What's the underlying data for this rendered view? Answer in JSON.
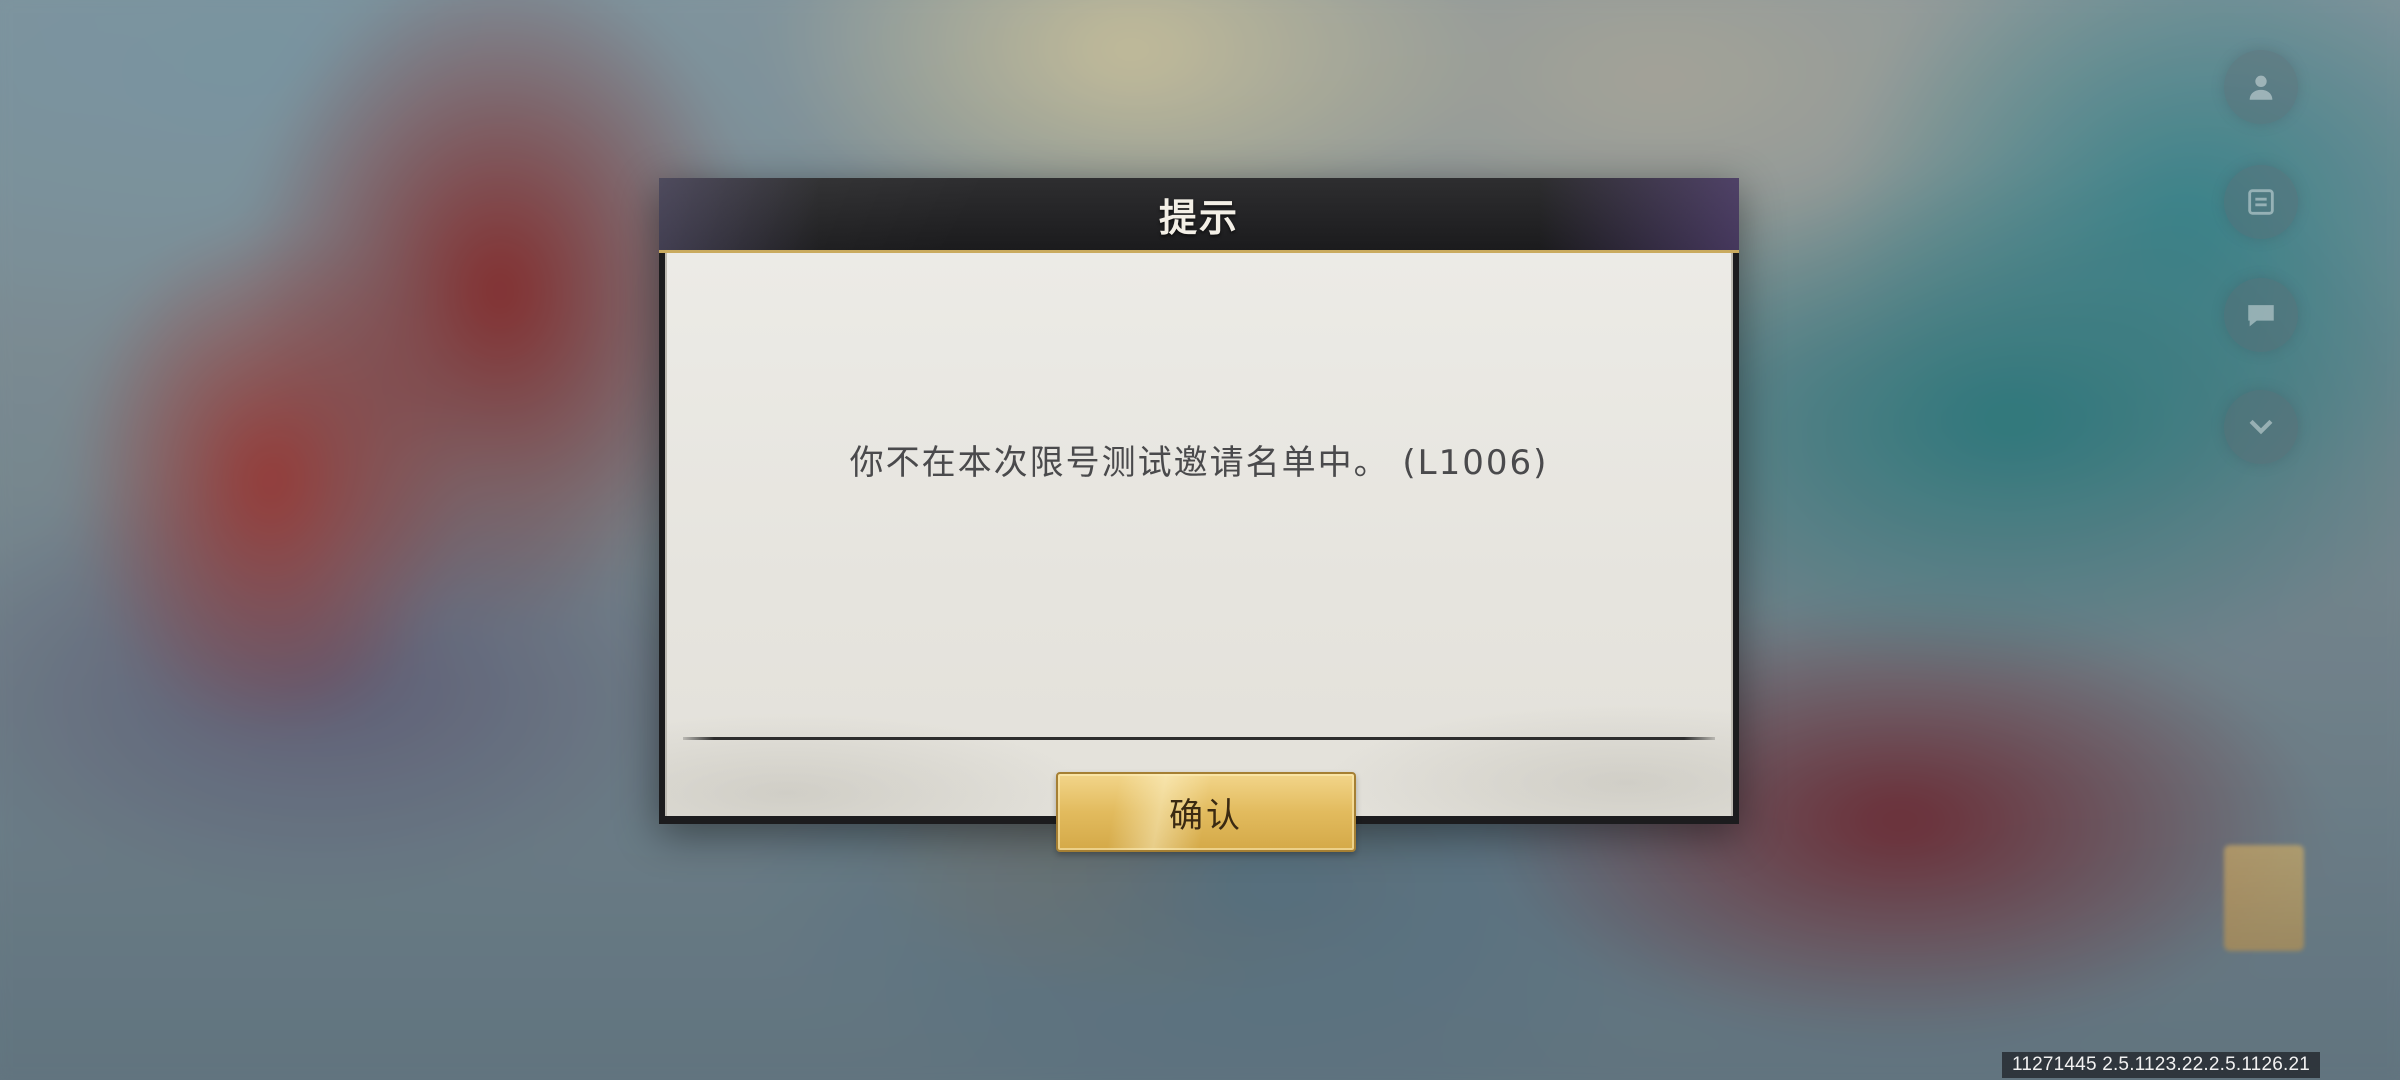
{
  "dialog": {
    "title": "提示",
    "message": "你不在本次限号测试邀请名单中。 (L1006)",
    "confirm_label": "确认"
  },
  "footer": {
    "build_version": "11271445 2.5.1123.22.2.5.1126.21"
  },
  "side_buttons": [
    {
      "icon": "profile-icon"
    },
    {
      "icon": "notice-icon"
    },
    {
      "icon": "chat-icon"
    },
    {
      "icon": "chevron-down-icon"
    }
  ],
  "colors": {
    "header_bg": "#1b1b1d",
    "header_border": "#c9aa5e",
    "body_bg": "#ecebe6",
    "message_text": "#4a4a4c",
    "button_gold": "#e2bb5e",
    "button_text": "#3b2a12"
  }
}
